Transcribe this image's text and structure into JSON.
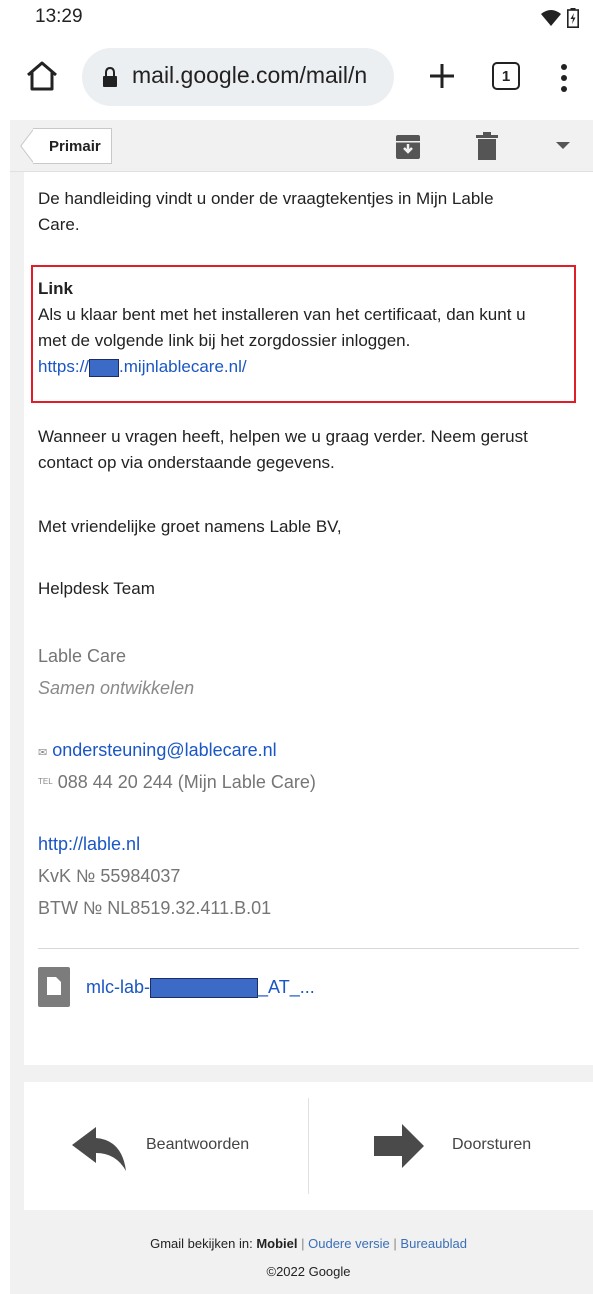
{
  "status_bar": {
    "time": "13:29"
  },
  "browser": {
    "url": "mail.google.com/mail/n",
    "tab_count": "1",
    "plus": "+"
  },
  "toolbar": {
    "primair_label": "Primair"
  },
  "email": {
    "intro_line1": "De handleiding vindt u onder de vraagtekentjes in Mijn Lable",
    "intro_line2": "Care.",
    "link_heading": "Link",
    "link_body_line1": "Als u klaar bent met het installeren van het certificaat, dan kunt u",
    "link_body_line2": "met de volgende link bij het zorgdossier inloggen.",
    "link_url_prefix": "https://",
    "link_url_suffix": ".mijnlablecare.nl/",
    "questions_line1": "Wanneer u vragen heeft, helpen we u graag verder. Neem gerust",
    "questions_line2": "contact op via onderstaande gegevens.",
    "greeting": "Met vriendelijke groet namens Lable BV,",
    "signature": "Helpdesk Team",
    "company": "Lable Care",
    "tagline": "Samen ontwikkelen",
    "email_icon": "✉",
    "email_address": "ondersteuning@lablecare.nl",
    "tel_prefix": "TEL",
    "phone": "088 44 20 244 (Mijn Lable Care)",
    "website": "http://lable.nl",
    "kvk": "KvK № 55984037",
    "btw": "BTW № NL8519.32.411.B.01",
    "attachment_prefix": "mlc-lab-",
    "attachment_suffix": "_AT_..."
  },
  "actions": {
    "reply_label": "Beantwoorden",
    "forward_label": "Doorsturen"
  },
  "footer": {
    "view_in": "Gmail bekijken in:",
    "mobile": "Mobiel",
    "sep": "|",
    "older": "Oudere versie",
    "desktop": "Bureaublad",
    "copyright": "©2022 Google"
  },
  "colors": {
    "link": "#1a56c4",
    "highlight": "#e11d2a",
    "redaction": "#3c6bc7",
    "footer_link": "#3b6fb6"
  }
}
